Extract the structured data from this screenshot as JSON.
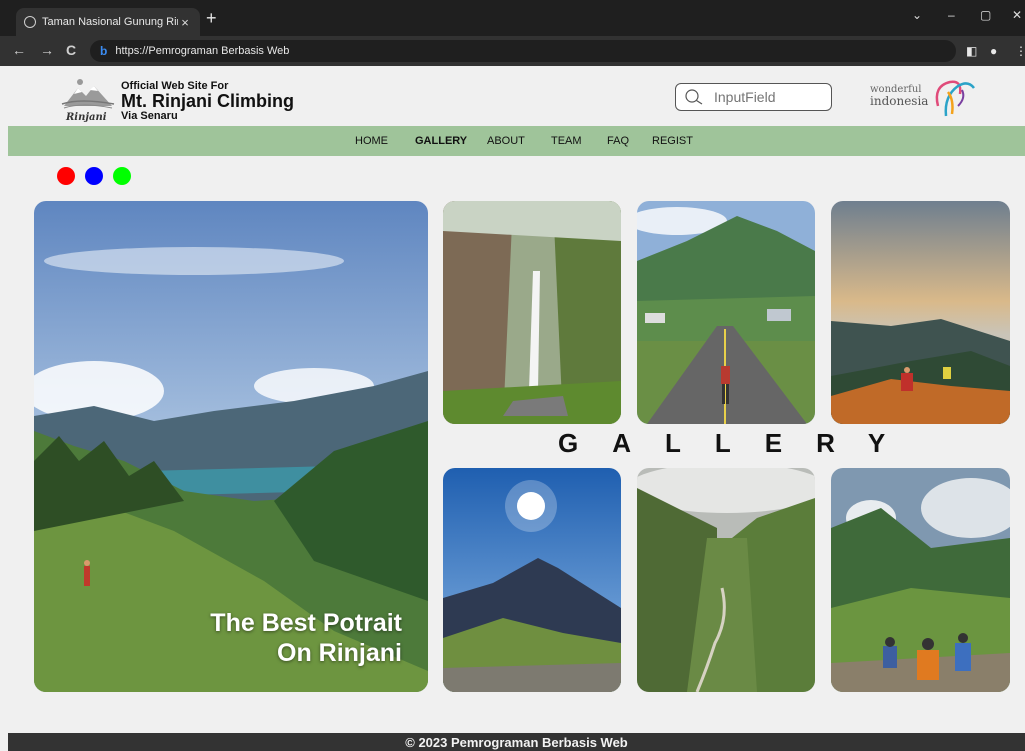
{
  "browser": {
    "tab_title": "Taman Nasional Gunung Rinjani",
    "tab_close": "×",
    "new_tab": "+",
    "url": "https://Pemrograman Berbasis Web",
    "window_controls": {
      "dropdown": "⌄",
      "minimize": "–",
      "restore": "▢",
      "close": "✕"
    }
  },
  "header": {
    "brand_line1": "Official Web Site For",
    "brand_line2": "Mt. Rinjani Climbing",
    "brand_line3": "Via Senaru",
    "logo_text": "Rinjani",
    "search_placeholder": "InputField",
    "partner_line1": "wonderful",
    "partner_line2": "indonesia"
  },
  "nav": {
    "items": [
      "HOME",
      "GALLERY",
      "ABOUT",
      "TEAM",
      "FAQ",
      "REGIST"
    ],
    "active": "GALLERY"
  },
  "colors": {
    "dot_red": "#ff0000",
    "dot_blue": "#0000ff",
    "dot_green": "#00ff00",
    "nav_bg": "#9fc49a",
    "footer_bg": "#333333"
  },
  "gallery": {
    "title": "GALLERY",
    "feature_caption_line1": "The Best Potrait",
    "feature_caption_line2": "On Rinjani"
  },
  "footer": {
    "text": "© 2023 Pemrograman Berbasis Web"
  }
}
